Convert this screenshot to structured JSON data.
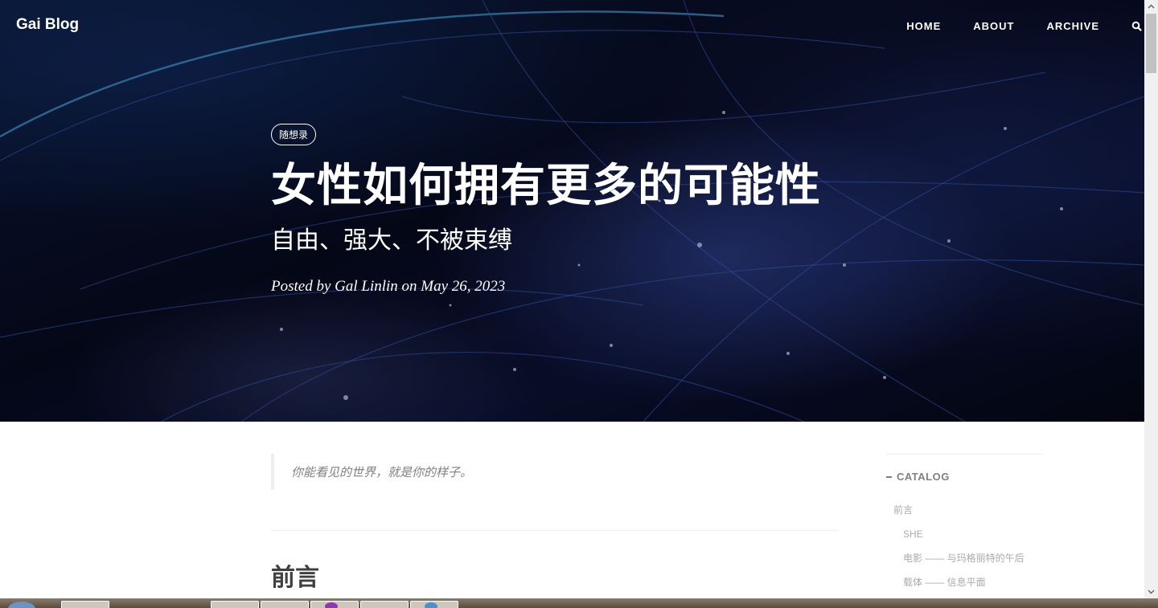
{
  "site": {
    "brand": "Gai Blog"
  },
  "nav": {
    "items": [
      {
        "label": "HOME"
      },
      {
        "label": "ABOUT"
      },
      {
        "label": "ARCHIVE"
      }
    ]
  },
  "post": {
    "tag": "随想录",
    "title": "女性如何拥有更多的可能性",
    "subtitle": "自由、强大、不被束缚",
    "meta": "Posted by Gal Linlin on May 26, 2023",
    "quote": "你能看见的世界，就是你的样子。",
    "section_heading": "前言"
  },
  "catalog": {
    "header": "CATALOG",
    "items": [
      {
        "label": "前言",
        "level": 1
      },
      {
        "label": "SHE",
        "level": 2
      },
      {
        "label": "电影 —— 与玛格丽特的午后",
        "level": 2
      },
      {
        "label": "载体 —— 信息平面",
        "level": 2
      }
    ]
  },
  "colors": {
    "hero_bg": "#06091c",
    "text_muted": "#808080",
    "catalog_text": "#aaaaaa",
    "heading_text": "#404040"
  },
  "icons": [
    "search-icon",
    "scroll-up-icon",
    "scroll-down-icon",
    "start-icon"
  ]
}
